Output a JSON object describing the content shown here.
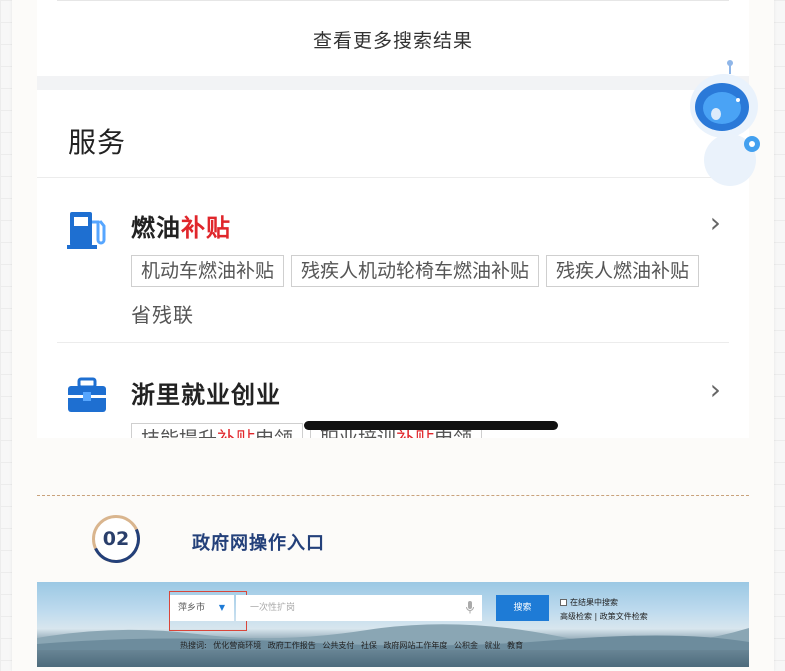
{
  "more_results": {
    "label": "查看更多搜索结果"
  },
  "services": {
    "title": "服务",
    "items": [
      {
        "title_prefix": "燃油",
        "title_highlight": "补贴",
        "tags": [
          "机动车燃油补贴",
          "残疾人机动轮椅车燃油补贴",
          "残疾人燃油补贴"
        ],
        "org": "省残联"
      },
      {
        "title": "浙里就业创业",
        "tags": [
          {
            "a": "技能提升",
            "hl": "补贴",
            "b": "申领"
          },
          {
            "a": "职业培训",
            "hl": "补贴",
            "b": "申领"
          }
        ]
      }
    ]
  },
  "step": {
    "number": "02",
    "title": "政府网操作入口"
  },
  "portal": {
    "city": "萍乡市",
    "search_placeholder": "一次性扩岗",
    "search_button": "搜索",
    "in_results": "在结果中搜索",
    "advanced": "高级检索",
    "separator": "|",
    "policy_docs": "政策文件检索",
    "hot_label": "热搜词:",
    "hot_words": [
      "优化营商环境",
      "政府工作报告",
      "公共支付",
      "社保",
      "政府网站工作年度",
      "公积金",
      "就业",
      "教育"
    ]
  },
  "colors": {
    "highlight": "#e0262b",
    "accent": "#1e7bd6",
    "brand_navy": "#23407a",
    "gold": "#d9b58e"
  },
  "icons": [
    "fuel-pump-icon",
    "briefcase-icon",
    "chevron-right-icon",
    "assistant-robot-icon",
    "microphone-icon",
    "dropdown-caret-icon"
  ]
}
